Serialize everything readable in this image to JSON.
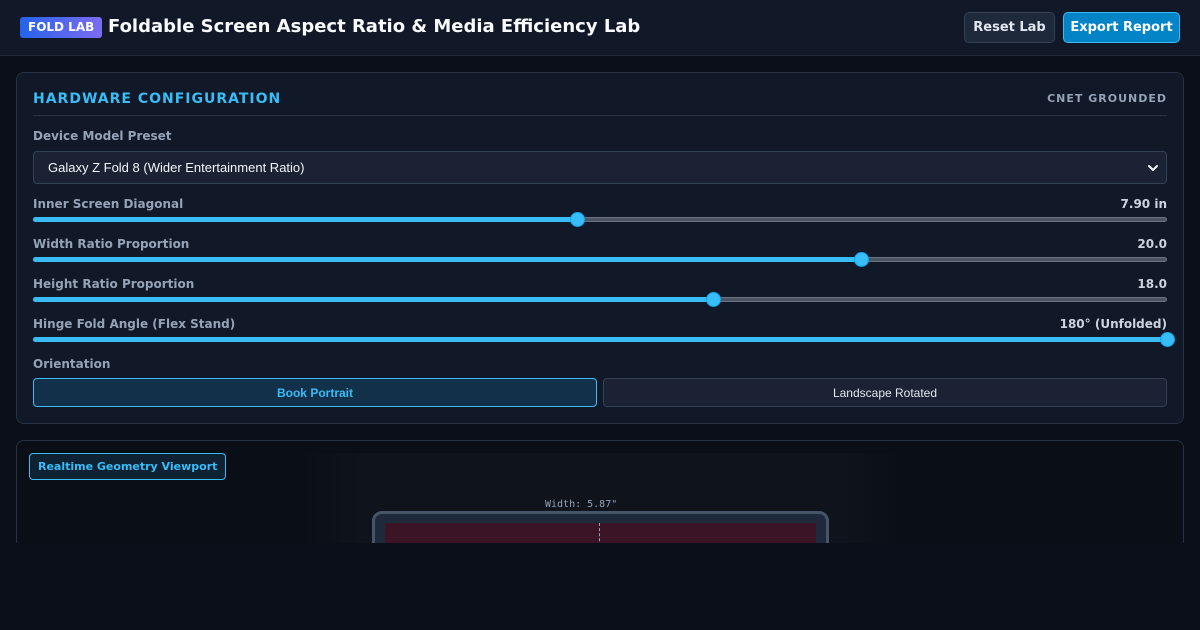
{
  "header": {
    "badge": "FOLD LAB",
    "title": "Foldable Screen Aspect Ratio & Media Efficiency Lab",
    "reset_label": "Reset Lab",
    "export_label": "Export Report"
  },
  "config": {
    "title": "HARDWARE CONFIGURATION",
    "tag": "CNET GROUNDED",
    "preset": {
      "label": "Device Model Preset",
      "value": "Galaxy Z Fold 8 (Wider Entertainment Ratio)"
    },
    "sliders": [
      {
        "label": "Inner Screen Diagonal",
        "display": "7.90 in",
        "level": 0.48
      },
      {
        "label": "Width Ratio Proportion",
        "display": "20.0",
        "level": 0.73
      },
      {
        "label": "Height Ratio Proportion",
        "display": "18.0",
        "level": 0.6
      },
      {
        "label": "Hinge Fold Angle (Flex Stand)",
        "display": "180° (Unfolded)",
        "level": 1.0
      }
    ],
    "orientation": {
      "label": "Orientation",
      "options": [
        "Book Portrait",
        "Landscape Rotated"
      ],
      "selected": "Book Portrait"
    }
  },
  "viewport": {
    "badge": "Realtime Geometry Viewport",
    "width_label": "Width: 5.87\""
  },
  "colors": {
    "accent": "#38bdf8",
    "background": "#0b0f19",
    "panel": "#111827",
    "screen": "#3b1526"
  }
}
